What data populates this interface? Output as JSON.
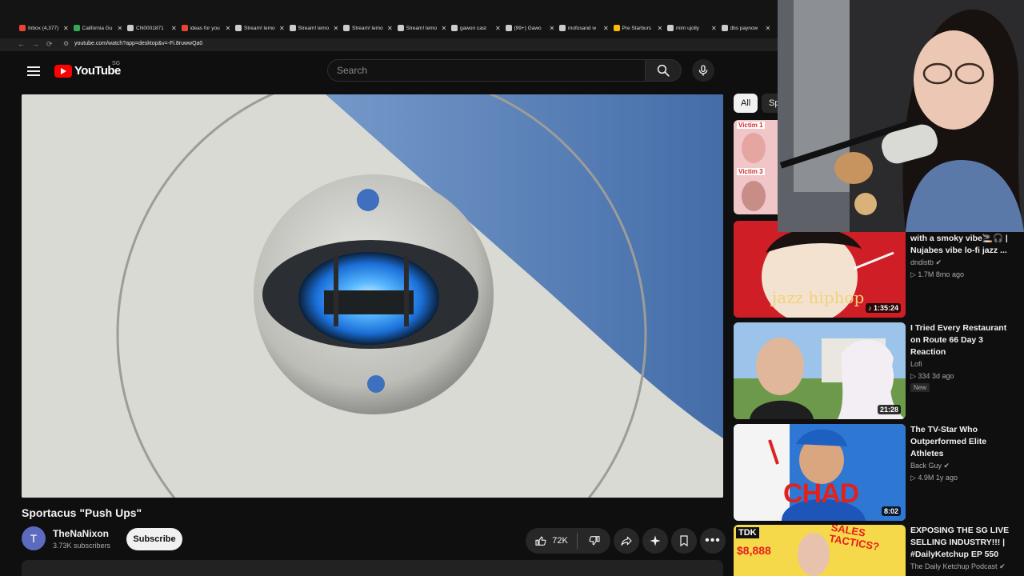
{
  "browser": {
    "tabs": [
      {
        "label": "Inbox (4,377)",
        "color": "#ea4335"
      },
      {
        "label": "California Gu",
        "color": "#34a853"
      },
      {
        "label": "CN0001871",
        "color": "#cccccc"
      },
      {
        "label": "ideas for you",
        "color": "#ea4335"
      },
      {
        "label": "Stream! lemo",
        "color": "#cccccc"
      },
      {
        "label": "Stream! lemo",
        "color": "#cccccc"
      },
      {
        "label": "Stream! lemo",
        "color": "#cccccc"
      },
      {
        "label": "Stream! lemo",
        "color": "#cccccc"
      },
      {
        "label": "gawon cast",
        "color": "#cccccc"
      },
      {
        "label": "(99+) Gawo",
        "color": "#cccccc"
      },
      {
        "label": "mofosand w",
        "color": "#cccccc"
      },
      {
        "label": "Pre Starburs",
        "color": "#fbbc05"
      },
      {
        "label": "mim ujolly",
        "color": "#cccccc"
      },
      {
        "label": "dbs paynow",
        "color": "#cccccc"
      }
    ],
    "close_glyph": "✕",
    "url": "youtube.com/watch?app=desktop&v=-Fi.8ruwwQa0"
  },
  "header": {
    "logo_text": "YouTube",
    "country_code": "SG",
    "search_placeholder": "Search"
  },
  "video": {
    "title": "Sportacus \"Push Ups\"",
    "channel": "TheNaNixon",
    "channel_initial": "T",
    "subscribers": "3.73K subscribers",
    "subscribe_label": "Subscribe",
    "likes": "72K"
  },
  "sidebar": {
    "chips": [
      "All",
      "Sp"
    ],
    "items": [
      {
        "title_lines": [
          "with a smoky vibe🚬🎧 |",
          "Nujabes vibe lo-fi jazz ..."
        ],
        "channel": "dndistb",
        "verified": true,
        "meta": "▷ 1.7M  8mo ago",
        "duration": "♪ 1:35:24",
        "thumb_text": "jazz hiphop"
      },
      {
        "title_lines": [
          "I Tried Every Restaurant",
          "on Route 66 Day 3",
          "Reaction"
        ],
        "channel": "Lofi",
        "verified": false,
        "meta": "▷ 334  3d ago",
        "badge": "New",
        "duration": "21:28"
      },
      {
        "title_lines": [
          "The TV-Star Who",
          "Outperformed Elite",
          "Athletes"
        ],
        "channel": "Back Guy",
        "verified": true,
        "meta": "▷ 4.9M  1y ago",
        "duration": "8:02",
        "thumb_text": "CHAD"
      },
      {
        "title_lines": [
          "EXPOSING THE SG LIVE",
          "SELLING INDUSTRY!!! |",
          "#DailyKetchup EP 550"
        ],
        "channel": "The Daily Ketchup Podcast",
        "verified": true,
        "thumb_text_a": "TDK",
        "thumb_text_b": "SALES TACTICS?",
        "thumb_text_c": "$8,888"
      }
    ],
    "top_thumb_labels": [
      "Victim 1",
      "Victim 3"
    ]
  }
}
